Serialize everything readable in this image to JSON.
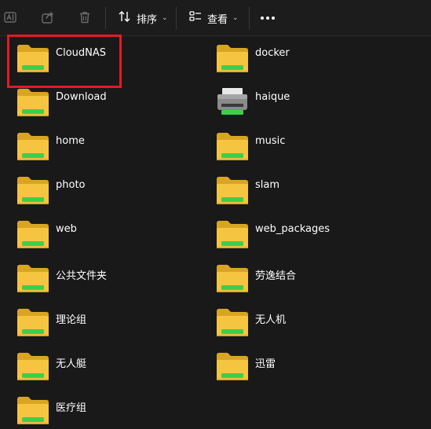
{
  "toolbar": {
    "sort_label": "排序",
    "view_label": "查看",
    "chevron": "⌄",
    "icons": [
      "rename-icon",
      "share-icon",
      "delete-icon",
      "sort-icon",
      "view-icon",
      "more-icon"
    ]
  },
  "colors": {
    "background": "#191919",
    "folder_yellow": "#f5c542",
    "folder_green": "#3ecf4a",
    "highlight": "#e21b23"
  },
  "items": [
    {
      "name": "CloudNAS",
      "icon": "folder-icon"
    },
    {
      "name": "docker",
      "icon": "folder-icon"
    },
    {
      "name": "Download",
      "icon": "folder-icon"
    },
    {
      "name": "haique",
      "icon": "printer-icon"
    },
    {
      "name": "home",
      "icon": "folder-icon"
    },
    {
      "name": "music",
      "icon": "folder-icon"
    },
    {
      "name": "photo",
      "icon": "folder-icon"
    },
    {
      "name": "slam",
      "icon": "folder-icon"
    },
    {
      "name": "web",
      "icon": "folder-icon"
    },
    {
      "name": "web_packages",
      "icon": "folder-icon"
    },
    {
      "name": "公共文件夹",
      "icon": "folder-icon"
    },
    {
      "name": "劳逸结合",
      "icon": "folder-icon"
    },
    {
      "name": "理论组",
      "icon": "folder-icon"
    },
    {
      "name": "无人机",
      "icon": "folder-icon"
    },
    {
      "name": "无人艇",
      "icon": "folder-icon"
    },
    {
      "name": "迅雷",
      "icon": "folder-icon"
    },
    {
      "name": "医疗组",
      "icon": "folder-icon"
    }
  ]
}
